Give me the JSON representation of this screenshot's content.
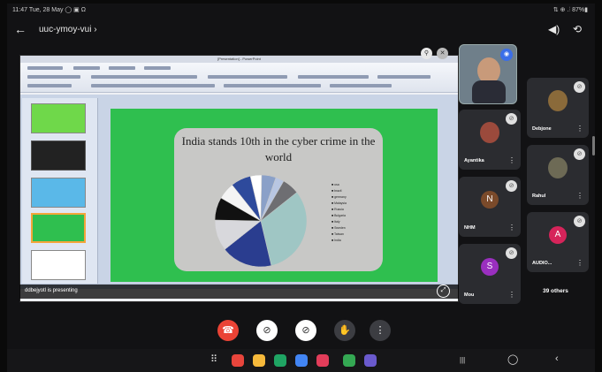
{
  "status_bar": {
    "left": "11:47  Tue, 28 May  ◯ ▣ Ω",
    "right": "⇅ ⊕ .⫶ 87%▮"
  },
  "header": {
    "back_icon": "←",
    "meeting_code": "uuc-ymoy-vui",
    "caret": "›",
    "speaker_icon": "◀)",
    "camera_switch_icon": "⟲"
  },
  "shared_screen": {
    "app_window_title": "[Presentation] - PowerPoint",
    "slide_title": "India stands 10th in the cyber crime in the world",
    "legend": [
      "usa",
      "brazil",
      "germany",
      "Malaysia",
      "Russia",
      "Bulgaria",
      "Italy",
      "Sweden",
      "Taiwan",
      "India"
    ],
    "presenter_caption": "ddbejyotl is presenting"
  },
  "chart_data": {
    "type": "pie",
    "title": "India stands 10th in the cyber crime in the world",
    "categories": [
      "usa",
      "brazil",
      "germany",
      "Malaysia",
      "Russia",
      "Bulgaria",
      "Italy",
      "Sweden",
      "Taiwan",
      "India"
    ],
    "values": [
      32,
      18,
      11,
      8,
      6,
      7,
      4,
      5,
      3,
      6
    ],
    "colors": [
      "#9fc6c4",
      "#2a3d8f",
      "#d8d8dc",
      "#111111",
      "#f4f4f4",
      "#2e4a9c",
      "#ffffff",
      "#8aa0c8",
      "#b8c6e2",
      "#6e6e72"
    ],
    "legend_position": "right"
  },
  "participants": [
    {
      "name": "",
      "kind": "self"
    },
    {
      "name": "Ayantika",
      "kind": "photo",
      "color": "#9b4a3c"
    },
    {
      "name": "Debjone",
      "kind": "photo",
      "color": "#8a6a3a"
    },
    {
      "name": "NHM",
      "initial": "N",
      "color": "#7a4a2a"
    },
    {
      "name": "Rahul",
      "kind": "photo",
      "color": "#6d6a55"
    },
    {
      "name": "Mou",
      "initial": "S",
      "color": "#9a2fbf"
    },
    {
      "name": "AUDIO...",
      "initial": "A",
      "color": "#d6245a"
    }
  ],
  "others_label": "39 others",
  "controls": {
    "end_call_icon": "☎",
    "video_icon": "⊘",
    "mic_icon": "⊘",
    "raise_hand_icon": "✋",
    "more_icon": "⋮"
  },
  "nav_bar": {
    "apps_icon": "⠿",
    "recents_icon": "|||",
    "home_icon": "◯",
    "back_icon": "‹"
  }
}
